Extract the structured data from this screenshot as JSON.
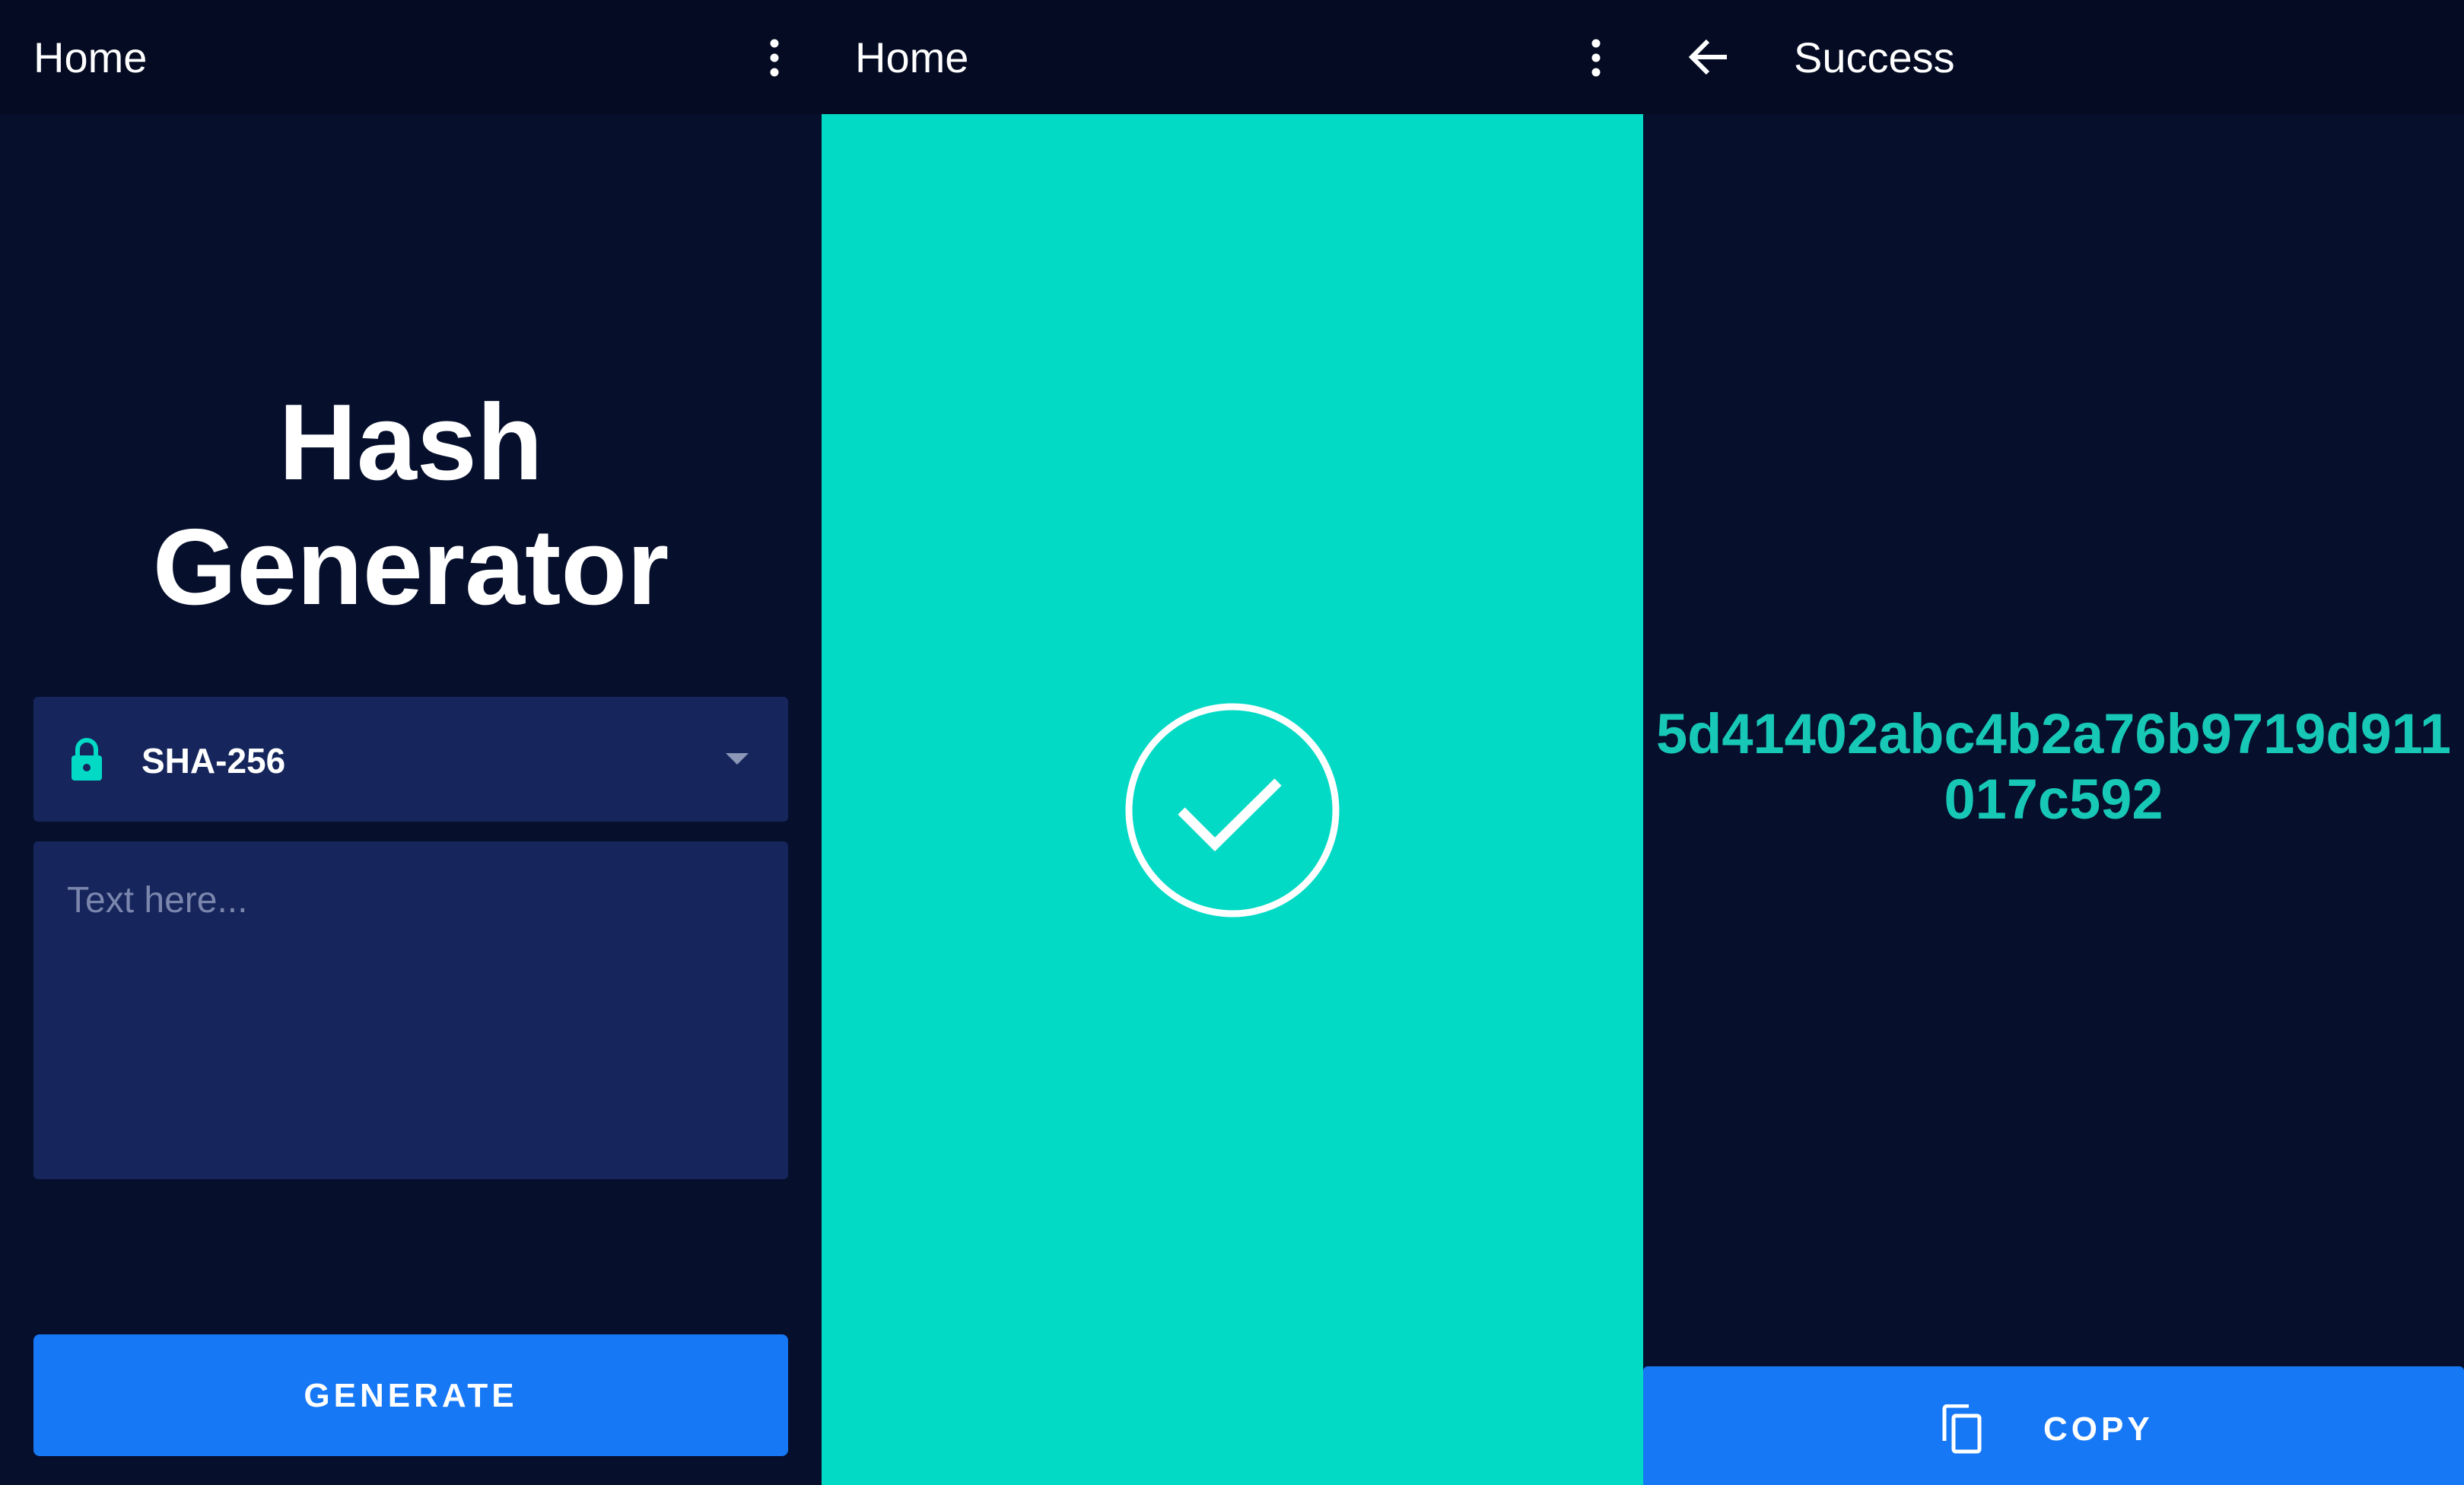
{
  "panel_1": {
    "topbar": {
      "title": "Home",
      "menu_icon": "more-vert-icon"
    },
    "app_title_line1": "Hash",
    "app_title_line2": "Generator",
    "algorithm_select": {
      "icon": "lock-icon",
      "selected": "SHA-256"
    },
    "text_input": {
      "placeholder": "Text here...",
      "value": ""
    },
    "generate_button": "GENERATE"
  },
  "panel_2": {
    "topbar": {
      "title": "Home",
      "menu_icon": "more-vert-icon"
    },
    "status_icon": "check-circle-icon"
  },
  "panel_3": {
    "topbar": {
      "title": "Success",
      "back_icon": "arrow-back-icon"
    },
    "hash_value": "5d41402abc4b2a76b9719d911017c592",
    "copy_button": {
      "icon": "copy-icon",
      "label": "COPY"
    }
  },
  "colors": {
    "background": "#060f2c",
    "topbar": "#040b22",
    "field": "#16265c",
    "accent_teal": "#03dac5",
    "hash_text": "#17c8b7",
    "button_blue": "#1778f6"
  }
}
